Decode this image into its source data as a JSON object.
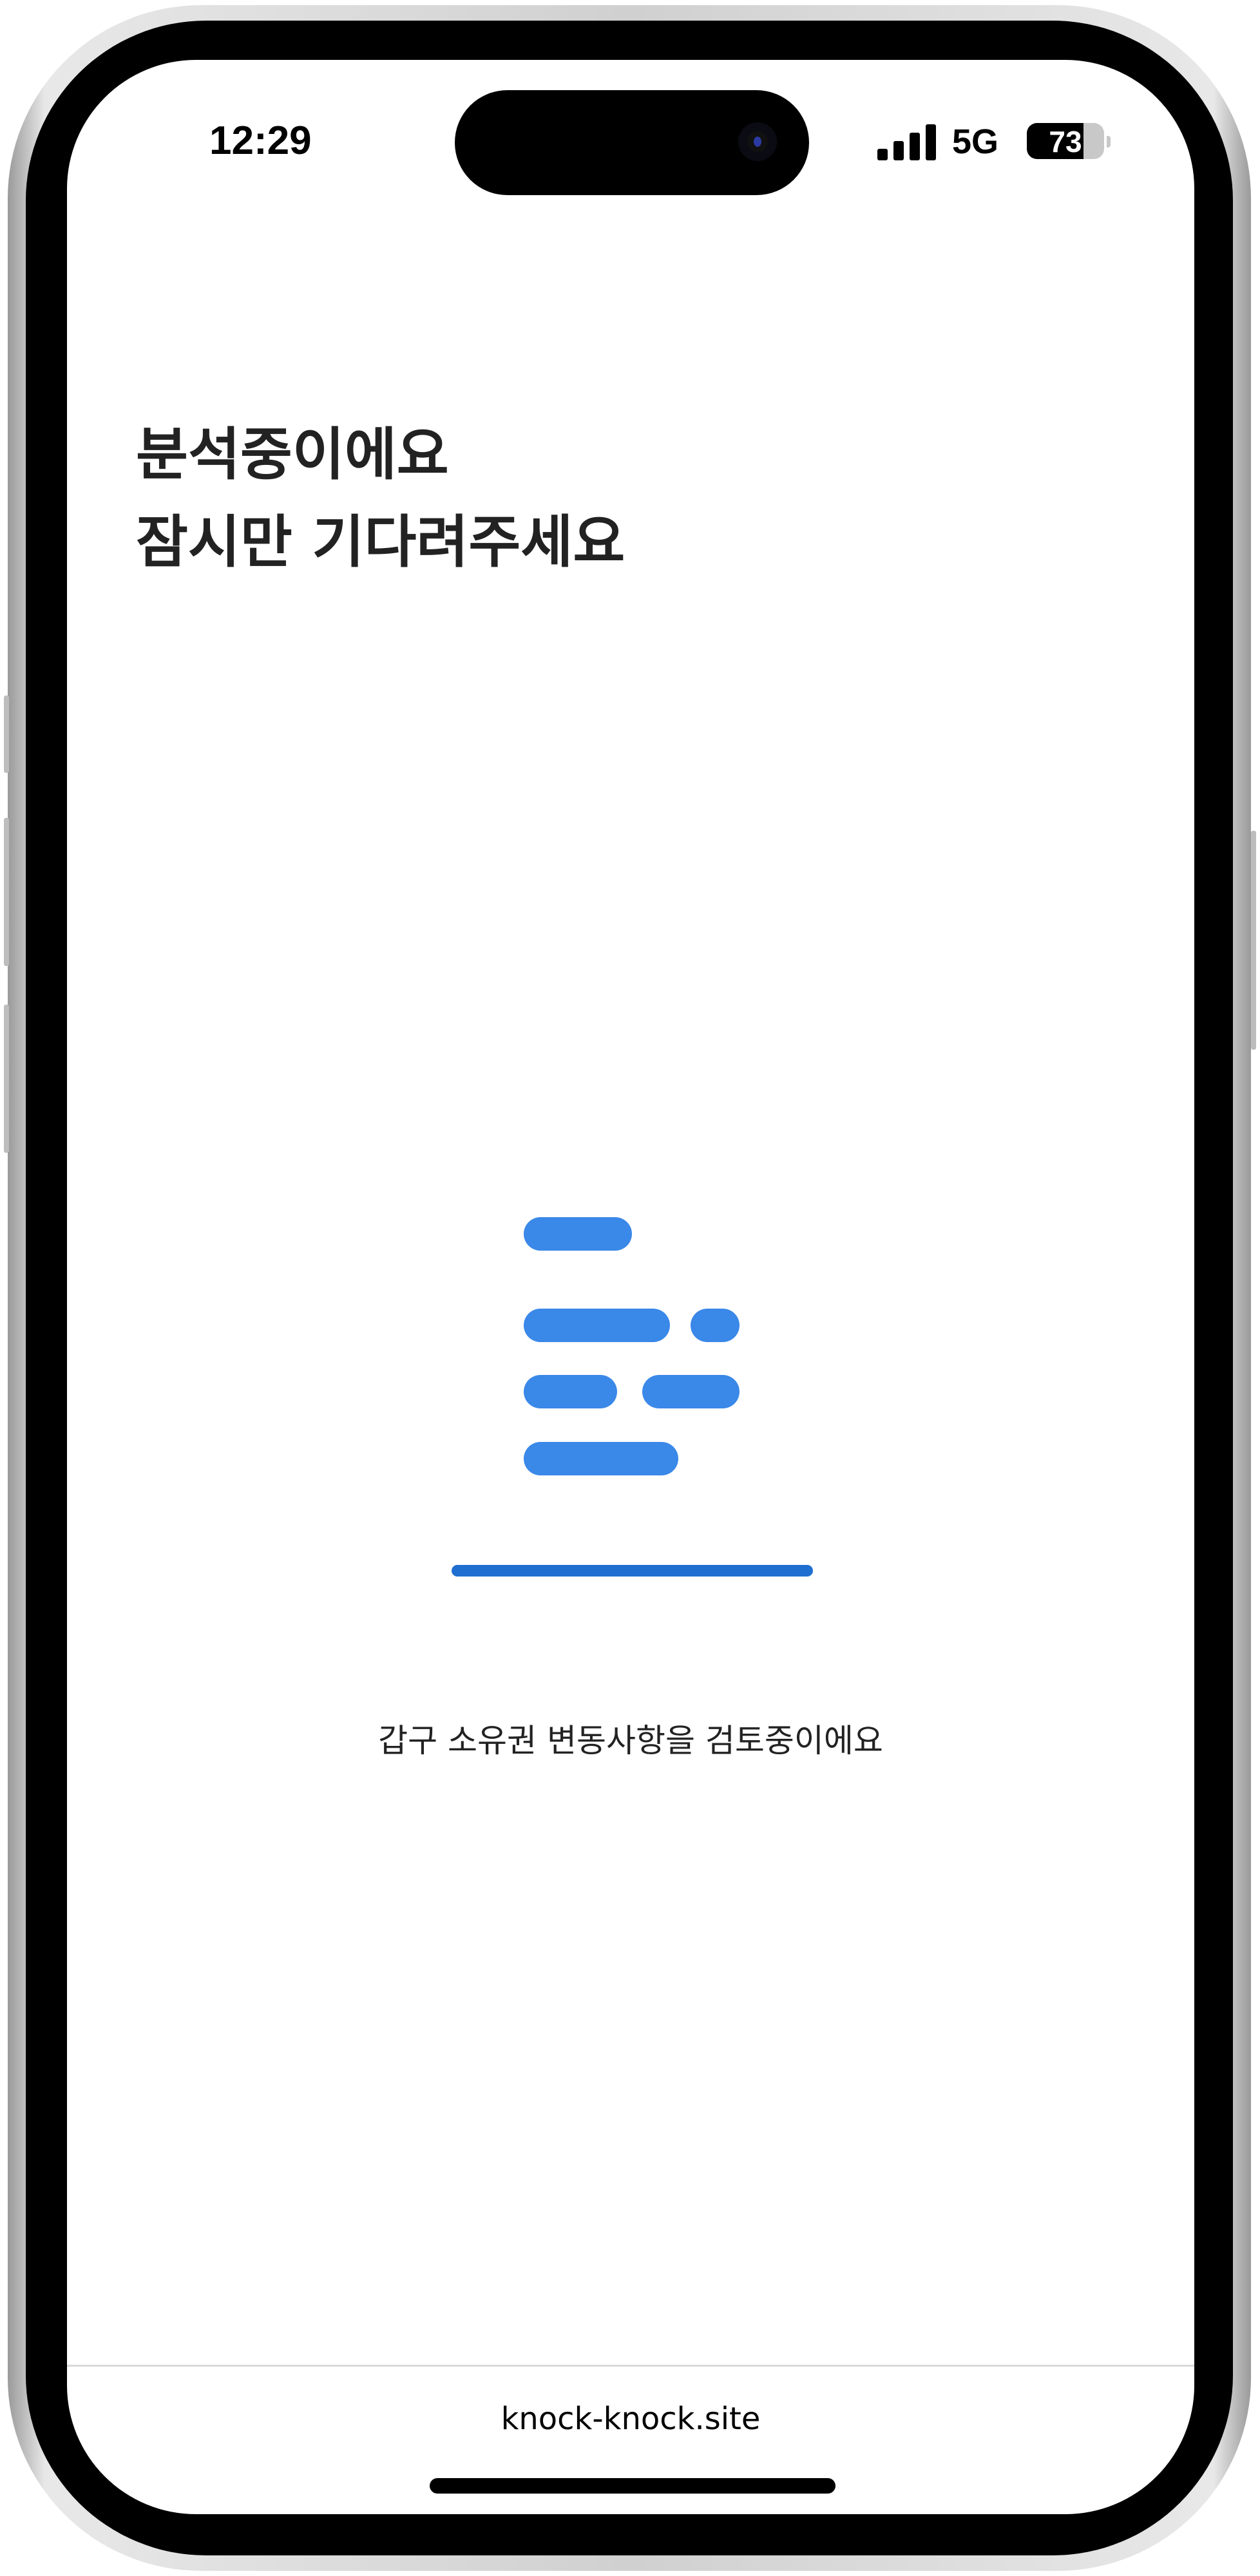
{
  "status_bar": {
    "time": "12:29",
    "network": "5G",
    "battery_level": "73",
    "battery_fraction": 0.73,
    "signal_bars": 4
  },
  "main": {
    "heading_line1": "분석중이에요",
    "heading_line2": "잠시만 기다려주세요",
    "loader_icon": "document-lines-icon",
    "accent_color": "#3a88e8",
    "progress_color": "#1f6fd0",
    "status_message": "갑구 소유권 변동사항을 검토중이에요"
  },
  "browser": {
    "url": "knock-knock.site"
  }
}
